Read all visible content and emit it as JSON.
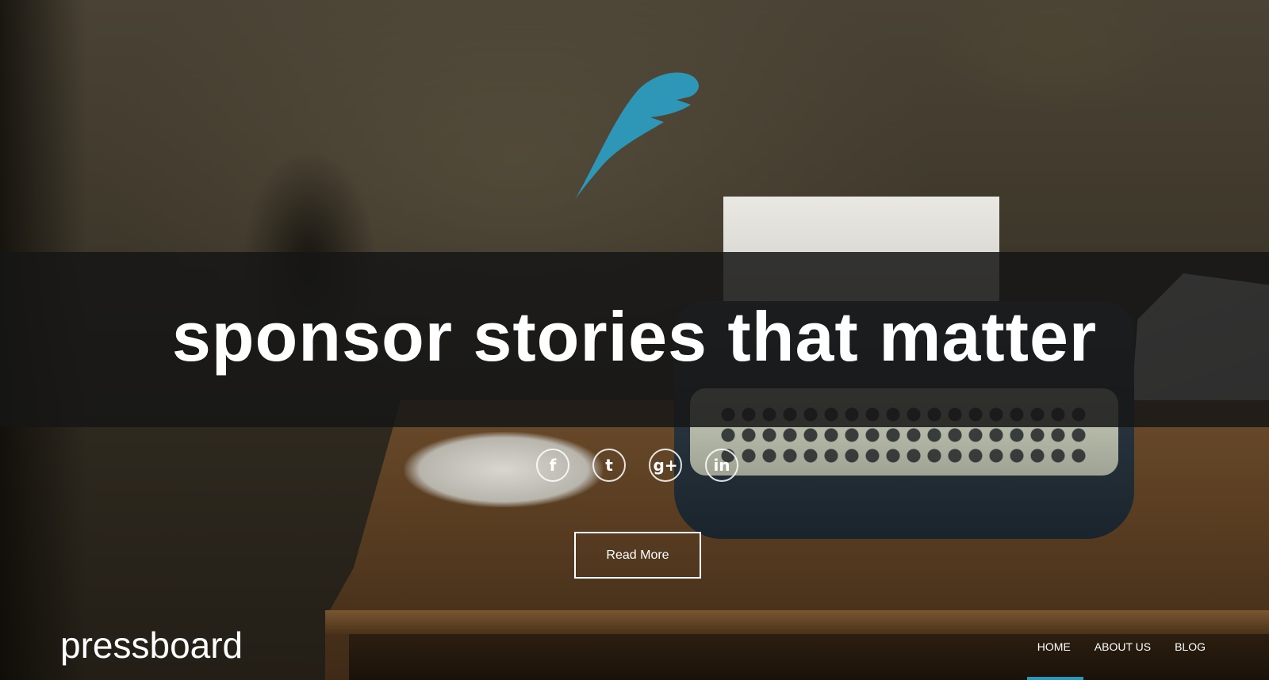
{
  "hero": {
    "headline": "sponsor stories that matter",
    "read_more_label": "Read More"
  },
  "social": {
    "facebook_glyph": "f",
    "twitter_glyph": "t",
    "googleplus_glyph": "g+",
    "linkedin_glyph": "in"
  },
  "brand": {
    "name": "pressboard",
    "accent_color": "#2e97b8"
  },
  "nav": {
    "items": [
      {
        "label": "HOME",
        "active": true
      },
      {
        "label": "ABOUT US",
        "active": false
      },
      {
        "label": "BLOG",
        "active": false
      }
    ]
  },
  "icons": {
    "logo": "feather-logo-icon",
    "facebook": "facebook-icon",
    "twitter": "twitter-icon",
    "googleplus": "google-plus-icon",
    "linkedin": "linkedin-icon"
  }
}
